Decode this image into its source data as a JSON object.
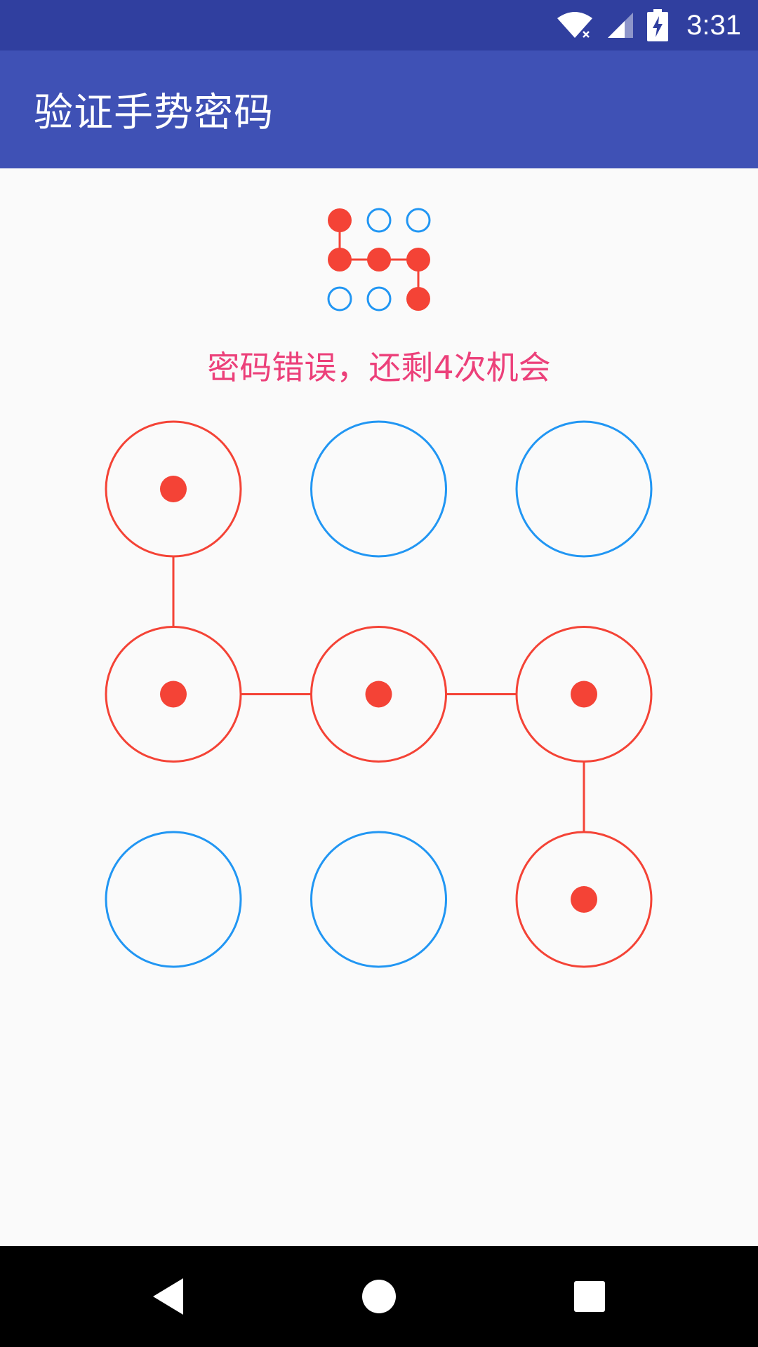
{
  "status_bar": {
    "time": "3:31",
    "icons": [
      "wifi-no-internet-icon",
      "cellular-signal-icon",
      "battery-charging-icon"
    ]
  },
  "app_bar": {
    "title": "验证手势密码"
  },
  "preview": {
    "selected": [
      true,
      false,
      false,
      true,
      true,
      true,
      false,
      false,
      true
    ],
    "path": [
      0,
      3,
      4,
      5,
      8
    ]
  },
  "message": "密码错误，还剩4次机会",
  "pattern_grid": {
    "nodes": [
      {
        "selected": true
      },
      {
        "selected": false
      },
      {
        "selected": false
      },
      {
        "selected": true
      },
      {
        "selected": true
      },
      {
        "selected": true
      },
      {
        "selected": false
      },
      {
        "selected": false
      },
      {
        "selected": true
      }
    ],
    "path": [
      0,
      3,
      4,
      5,
      8
    ]
  },
  "nav_bar": {
    "icons": [
      "back-icon",
      "home-icon",
      "recents-icon"
    ]
  },
  "colors": {
    "status_bar": "#303f9f",
    "app_bar": "#3f51b5",
    "error": "#f44336",
    "normal": "#2196f3",
    "message": "#ec407a",
    "background": "#fafafa"
  }
}
